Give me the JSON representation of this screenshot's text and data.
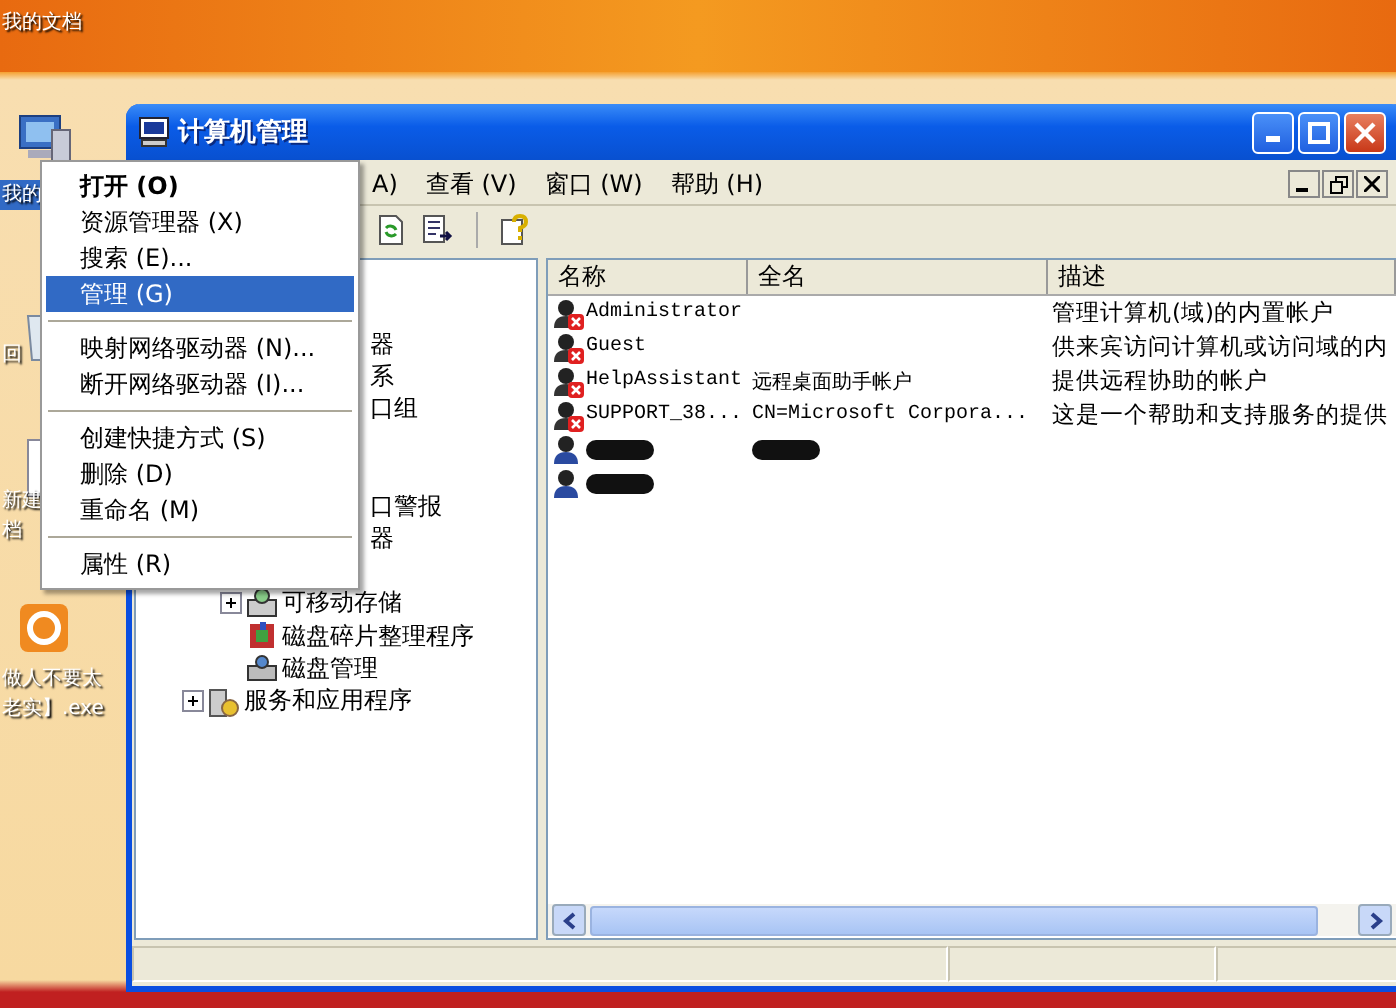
{
  "desktop": {
    "icons": [
      {
        "kind": "documents",
        "lines": [
          "我的文档"
        ],
        "selected": false
      },
      {
        "kind": "computer",
        "lines": [
          "我的"
        ],
        "selected": true
      },
      {
        "kind": "recycle",
        "lines": [
          "回"
        ],
        "selected": false
      },
      {
        "kind": "document",
        "lines": [
          "新建",
          "档"
        ],
        "selected": false
      },
      {
        "kind": "exe",
        "lines": [
          "做人不要太",
          "老实】.exe"
        ],
        "selected": false
      }
    ]
  },
  "window": {
    "title": "计算机管理",
    "menu": [
      "A)",
      "查看 (V)",
      "窗口 (W)",
      "帮助 (H)"
    ],
    "tree": [
      {
        "children": [
          {
            "children": [
              {
                "kind": "cut",
                "label": "器"
              },
              {
                "kind": "cut",
                "label": "系"
              },
              {
                "kind": "cut",
                "label": "口组"
              },
              {
                "kind": "covered"
              },
              {
                "kind": "covered"
              },
              {
                "kind": "cut",
                "label": "口警报"
              },
              {
                "kind": "cut",
                "label": "器"
              }
            ]
          },
          {
            "children": [
              {
                "kind": "storage",
                "label": "可移动存储",
                "expanded": false
              },
              {
                "kind": "defrag",
                "label": "磁盘碎片整理程序"
              },
              {
                "kind": "disk",
                "label": "磁盘管理"
              }
            ]
          },
          {
            "kind": "services",
            "label": "服务和应用程序",
            "expanded": false
          }
        ]
      }
    ],
    "list": {
      "columns": [
        "名称",
        "全名",
        "描述"
      ],
      "rows": [
        {
          "name": "Administrator",
          "description": "管理计算机(域)的内置帐户",
          "disabled": true
        },
        {
          "name": "Guest",
          "description": "供来宾访问计算机或访问域的内",
          "disabled": true
        },
        {
          "name": "HelpAssistant",
          "full_name": "远程桌面助手帐户",
          "description": "提供远程协助的帐户",
          "disabled": true
        },
        {
          "name": "SUPPORT_38...",
          "full_name": "CN=Microsoft Corpora...",
          "description": "这是一个帮助和支持服务的提供",
          "disabled": true
        },
        {
          "name_redacted": true,
          "full_name_redacted": true,
          "disabled": false
        },
        {
          "name_redacted": true,
          "disabled": false
        }
      ]
    }
  },
  "context_menu": {
    "items": [
      {
        "kind": "item",
        "label": "打开 (O)",
        "default": true,
        "selected": false
      },
      {
        "kind": "item",
        "label": "资源管理器 (X)",
        "default": false,
        "selected": false
      },
      {
        "kind": "item",
        "label": "搜索 (E)...",
        "default": false,
        "selected": false
      },
      {
        "kind": "item",
        "label": "管理 (G)",
        "default": false,
        "selected": true
      },
      {
        "kind": "separator"
      },
      {
        "kind": "item",
        "label": "映射网络驱动器 (N)...",
        "default": false,
        "selected": false
      },
      {
        "kind": "item",
        "label": "断开网络驱动器 (I)...",
        "default": false,
        "selected": false
      },
      {
        "kind": "separator"
      },
      {
        "kind": "item",
        "label": "创建快捷方式 (S)",
        "default": false,
        "selected": false
      },
      {
        "kind": "item",
        "label": "删除 (D)",
        "default": false,
        "selected": false
      },
      {
        "kind": "item",
        "label": "重命名 (M)",
        "default": false,
        "selected": false
      },
      {
        "kind": "separator"
      },
      {
        "kind": "item",
        "label": "属性 (R)",
        "default": false,
        "selected": false
      }
    ]
  }
}
